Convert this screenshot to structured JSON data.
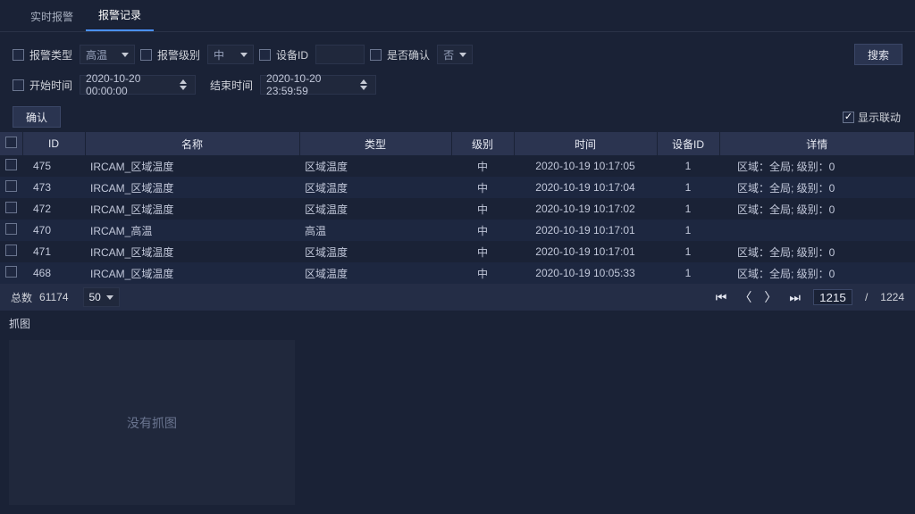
{
  "tabs": {
    "realtime": "实时报警",
    "history": "报警记录"
  },
  "filters": {
    "alarmTypeLabel": "报警类型",
    "alarmTypeValue": "高温",
    "alarmLevelLabel": "报警级别",
    "alarmLevelValue": "中",
    "deviceIdLabel": "设备ID",
    "deviceIdValue": "",
    "confirmLabel": "是否确认",
    "confirmValue": "否",
    "startLabel": "开始时间",
    "startValue": "2020-10-20 00:00:00",
    "endLabel": "结束时间",
    "endValue": "2020-10-20 23:59:59",
    "searchBtn": "搜索",
    "confirmBtn": "确认",
    "showLinkage": "显示联动"
  },
  "table": {
    "headers": [
      "",
      "ID",
      "名称",
      "类型",
      "级别",
      "时间",
      "设备ID",
      "详情"
    ],
    "rows": [
      {
        "id": "475",
        "name": "IRCAM_区域温度",
        "type": "区域温度",
        "level": "中",
        "time": "2020-10-19 10:17:05",
        "deviceId": "1",
        "detail": "区域：全局;  级别：0"
      },
      {
        "id": "473",
        "name": "IRCAM_区域温度",
        "type": "区域温度",
        "level": "中",
        "time": "2020-10-19 10:17:04",
        "deviceId": "1",
        "detail": "区域：全局;  级别：0"
      },
      {
        "id": "472",
        "name": "IRCAM_区域温度",
        "type": "区域温度",
        "level": "中",
        "time": "2020-10-19 10:17:02",
        "deviceId": "1",
        "detail": "区域：全局;  级别：0"
      },
      {
        "id": "470",
        "name": "IRCAM_高温",
        "type": "高温",
        "level": "中",
        "time": "2020-10-19 10:17:01",
        "deviceId": "1",
        "detail": ""
      },
      {
        "id": "471",
        "name": "IRCAM_区域温度",
        "type": "区域温度",
        "level": "中",
        "time": "2020-10-19 10:17:01",
        "deviceId": "1",
        "detail": "区域：全局;  级别：0"
      },
      {
        "id": "468",
        "name": "IRCAM_区域温度",
        "type": "区域温度",
        "level": "中",
        "time": "2020-10-19 10:05:33",
        "deviceId": "1",
        "detail": "区域：全局;  级别：0"
      }
    ]
  },
  "pagination": {
    "totalLabel": "总数",
    "total": "61174",
    "pageSize": "50",
    "current": "1215",
    "sep": "/",
    "totalPages": "1224"
  },
  "snapshot": {
    "title": "抓图",
    "empty": "没有抓图"
  }
}
